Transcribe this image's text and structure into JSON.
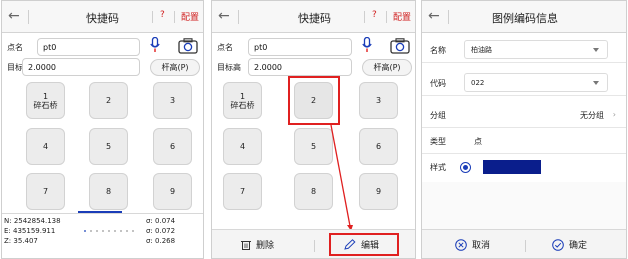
{
  "colors": {
    "accent_red": "#d02020",
    "highlight_red": "#e02020",
    "brand_blue": "#1a3db8",
    "swatch": "#0a1e8c"
  },
  "panel1": {
    "title": "快捷码",
    "help_label": "?",
    "config_label": "配置",
    "point_name_label": "点名",
    "point_name_value": "pt0",
    "target_height_label": "目标高",
    "target_height_value": "2.0000",
    "pole_height_button": "杆高(P)",
    "keys": [
      {
        "number": "1",
        "caption": "碎石桥"
      },
      {
        "number": "2",
        "caption": ""
      },
      {
        "number": "3",
        "caption": ""
      },
      {
        "number": "4",
        "caption": ""
      },
      {
        "number": "5",
        "caption": ""
      },
      {
        "number": "6",
        "caption": ""
      },
      {
        "number": "7",
        "caption": ""
      },
      {
        "number": "8",
        "caption": ""
      },
      {
        "number": "9",
        "caption": ""
      }
    ],
    "status": {
      "n": "N: 2542854.138",
      "e": "E: 435159.911",
      "z": "Z: 35.407",
      "s1": "σ: 0.074",
      "s2": "σ: 0.072",
      "s3": "σ: 0.268"
    }
  },
  "panel2": {
    "title": "快捷码",
    "help_label": "?",
    "config_label": "配置",
    "point_name_label": "点名",
    "point_name_value": "pt0",
    "target_height_label": "目标高",
    "target_height_value": "2.0000",
    "pole_height_button": "杆高(P)",
    "keys": [
      {
        "number": "1",
        "caption": "碎石桥"
      },
      {
        "number": "2",
        "caption": ""
      },
      {
        "number": "3",
        "caption": ""
      },
      {
        "number": "4",
        "caption": ""
      },
      {
        "number": "5",
        "caption": ""
      },
      {
        "number": "6",
        "caption": ""
      },
      {
        "number": "7",
        "caption": ""
      },
      {
        "number": "8",
        "caption": ""
      },
      {
        "number": "9",
        "caption": ""
      }
    ],
    "delete_label": "删除",
    "edit_label": "编辑"
  },
  "panel3": {
    "title": "图例编码信息",
    "name_label": "名称",
    "name_value": "柏油路",
    "code_label": "代码",
    "code_value": "022",
    "group_label": "分组",
    "group_value": "无分组",
    "type_label": "类型",
    "type_value": "点",
    "style_label": "样式",
    "cancel_label": "取消",
    "confirm_label": "确定"
  }
}
